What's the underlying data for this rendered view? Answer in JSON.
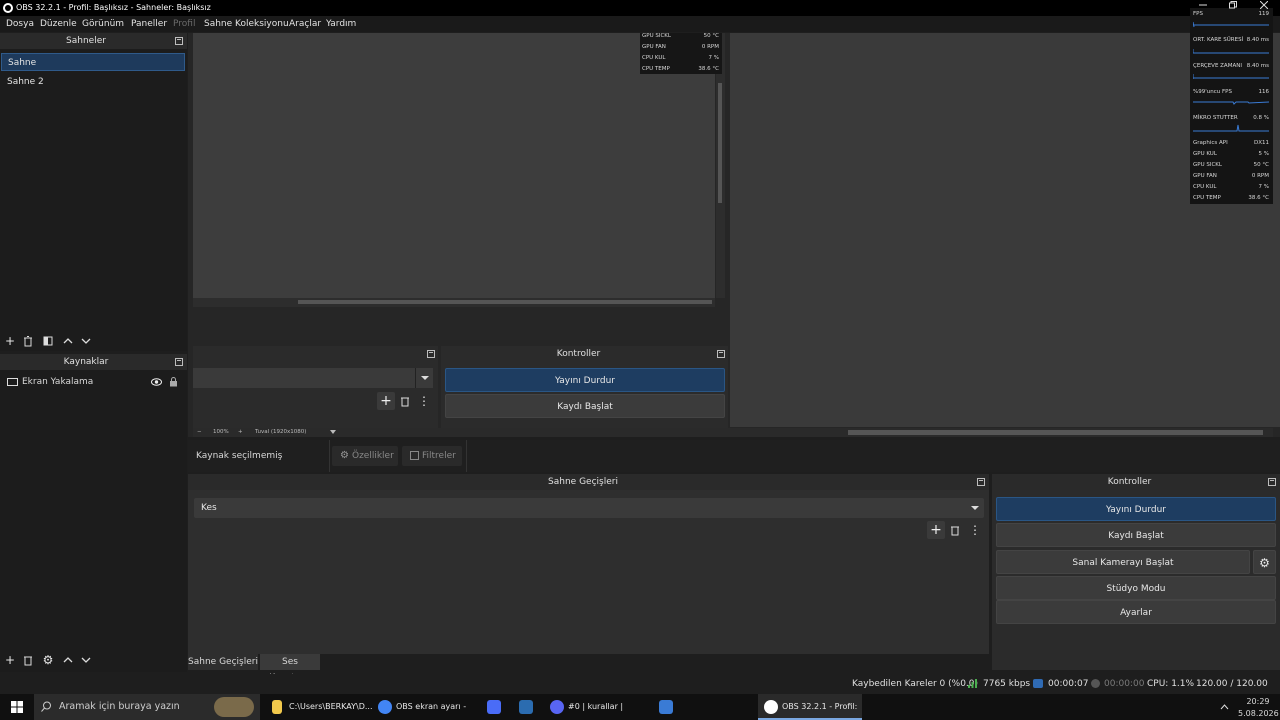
{
  "window": {
    "title": "OBS 32.2.1 - Profil: Başlıksız - Sahneler: Başlıksız"
  },
  "menu": [
    "Dosya",
    "Düzenle",
    "Görünüm",
    "Paneller",
    "Profil",
    "Sahne Koleksiyonu",
    "Araçlar",
    "Yardım"
  ],
  "scenes": {
    "title": "Sahneler",
    "items": [
      "Sahne",
      "Sahne 2"
    ]
  },
  "sources": {
    "title": "Kaynaklar",
    "items": [
      "Ekran Yakalama"
    ]
  },
  "preview_stats": [
    {
      "label": "GPU SICKL",
      "value": "50 °C"
    },
    {
      "label": "GPU FAN",
      "value": "0 RPM"
    },
    {
      "label": "CPU KUL",
      "value": "7 %"
    },
    {
      "label": "CPU TEMP",
      "value": "38.6 °C"
    }
  ],
  "inner_controls": {
    "title": "Kontroller",
    "stop_stream": "Yayını Durdur",
    "start_record": "Kaydı Başlat"
  },
  "zoom_bar": {
    "minus": "−",
    "zoom": "100%",
    "plus": "+",
    "canvas": "Tuval (1920x1080)"
  },
  "source_toolbar": {
    "none_selected": "Kaynak seçilmemiş",
    "properties": "Özellikler",
    "filters": "Filtreler"
  },
  "transitions": {
    "title": "Sahne Geçişleri",
    "selected": "Kes"
  },
  "controls": {
    "title": "Kontroller",
    "stop_stream": "Yayını Durdur",
    "start_record": "Kaydı Başlat",
    "virtual_cam": "Sanal Kamerayı Başlat",
    "studio_mode": "Stüdyo Modu",
    "settings": "Ayarlar"
  },
  "bottom_tabs": [
    "Sahne Geçişleri",
    "Ses Karıştırıcı"
  ],
  "statusbar": {
    "dropped": "Kaybedilen Kareler 0 (%0.0)",
    "bitrate": "7765 kbps",
    "stream_time": "00:00:07",
    "rec_time": "00:00:00",
    "cpu": "CPU: 1.1%",
    "fps": "120.00 / 120.00 FPS"
  },
  "overlay": {
    "fps_label": "FPS",
    "fps_value": "119",
    "frametime_label": "ORT. KARE SÜRESİ",
    "frametime_value": "8.40 ms",
    "frame_label": "ÇERÇEVE ZAMANI",
    "frame_value": "8.40 ms",
    "low_label": "%99'uncu FPS",
    "low_value": "116",
    "stutter_label": "MİKRO STUTTER",
    "stutter_value": "0.8 %",
    "rows": [
      {
        "label": "Graphics API",
        "value": "DX11"
      },
      {
        "label": "GPU KUL",
        "value": "5 %"
      },
      {
        "label": "GPU SICKL",
        "value": "50 °C"
      },
      {
        "label": "GPU FAN",
        "value": "0 RPM"
      },
      {
        "label": "CPU KUL",
        "value": "7 %"
      },
      {
        "label": "CPU TEMP",
        "value": "38.6 °C"
      }
    ]
  },
  "taskbar": {
    "search_placeholder": "Aramak için buraya yazın",
    "apps": [
      {
        "label": "C:\\Users\\BERKAY\\D...",
        "color": "#f2c94c"
      },
      {
        "label": "OBS ekran ayarı - G...",
        "color": "#4285f4"
      },
      {
        "label": "",
        "color": "#4a6cf7"
      },
      {
        "label": "",
        "color": "#2b6cb0"
      },
      {
        "label": "#0 | kurallar | Kick...",
        "color": "#5865f2"
      },
      {
        "label": "",
        "color": "#3a7bd5"
      },
      {
        "label": "OBS 32.2.1 - Profil: ...",
        "color": "#ffffff"
      }
    ],
    "clock_time": "20:29",
    "clock_date": "5.08.2026"
  },
  "colors": {
    "accent": "#1e3d61",
    "panel": "#2b2b2b",
    "background": "#1e1e1e"
  }
}
